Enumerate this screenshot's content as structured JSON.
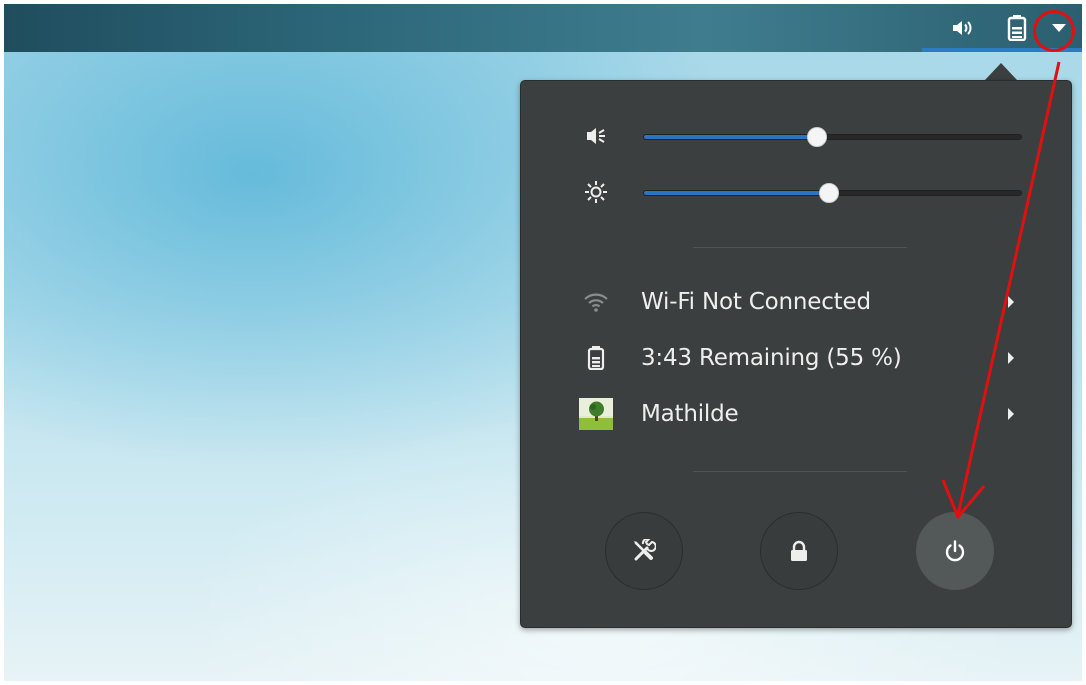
{
  "topbar": {
    "icons": [
      "volume-icon",
      "battery-icon",
      "menu-dropdown-icon"
    ]
  },
  "system_menu": {
    "volume": {
      "icon": "speaker-icon",
      "level_fraction": 0.46
    },
    "brightness": {
      "icon": "brightness-icon",
      "level_fraction": 0.49
    },
    "items": [
      {
        "icon": "wifi-icon",
        "label": "Wi-Fi Not Connected"
      },
      {
        "icon": "battery-icon",
        "label": "3:43 Remaining (55 %)"
      },
      {
        "icon": "user-avatar",
        "label": "Mathilde"
      }
    ],
    "actions": [
      "settings-icon",
      "lock-icon",
      "power-icon"
    ]
  },
  "colors": {
    "accent": "#2c72c7",
    "menu_bg": "#3b3f3f",
    "annotation": "#e01010"
  }
}
